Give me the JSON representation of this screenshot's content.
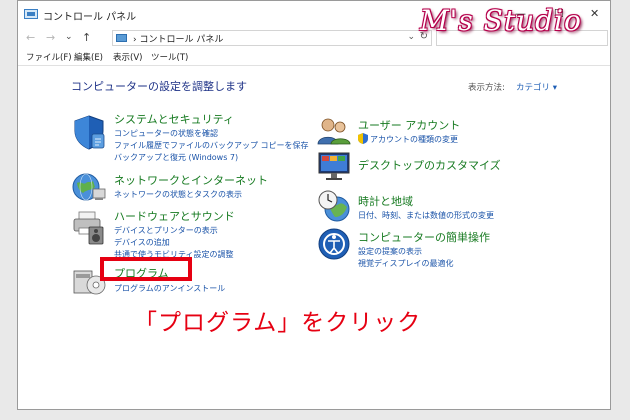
{
  "window": {
    "title": "コントロール パネル",
    "controls": [
      "—",
      "☐",
      "✕"
    ]
  },
  "watermark": "M's Studio",
  "address": {
    "back": "←",
    "forward": "→",
    "recent": "⌄",
    "up": "↑",
    "path": "› コントロール パネル",
    "dropdown": "⌄",
    "refresh": "↻"
  },
  "menu": [
    "ファイル(F)",
    "編集(E)",
    "表示(V)",
    "ツール(T)"
  ],
  "heading": "コンピューターの設定を調整します",
  "view_by": {
    "label": "表示方法:",
    "value": "カテゴリ ▾"
  },
  "categories": {
    "system": {
      "title": "システムとセキュリティ",
      "links": [
        "コンピューターの状態を確認",
        "ファイル履歴でファイルのバックアップ コピーを保存",
        "バックアップと復元 (Windows 7)"
      ]
    },
    "network": {
      "title": "ネットワークとインターネット",
      "links": [
        "ネットワークの状態とタスクの表示"
      ]
    },
    "hardware": {
      "title": "ハードウェアとサウンド",
      "links": [
        "デバイスとプリンターの表示",
        "デバイスの追加",
        "共通で使うモビリティ設定の調整"
      ]
    },
    "programs": {
      "title": "プログラム",
      "links": [
        "プログラムのアンインストール"
      ]
    },
    "accounts": {
      "title": "ユーザー アカウント",
      "links": [
        "アカウントの種類の変更"
      ]
    },
    "appearance": {
      "title": "デスクトップのカスタマイズ",
      "links": []
    },
    "clock": {
      "title": "時計と地域",
      "links": [
        "日付、時刻、または数値の形式の変更"
      ]
    },
    "ease": {
      "title": "コンピューターの簡単操作",
      "links": [
        "設定の提案の表示",
        "視覚ディスプレイの最適化"
      ]
    }
  },
  "instruction": "「プログラム」をクリック",
  "colors": {
    "category_title": "#167a20",
    "link": "#1a53a8",
    "heading": "#1e3287",
    "highlight": "#e60012"
  }
}
